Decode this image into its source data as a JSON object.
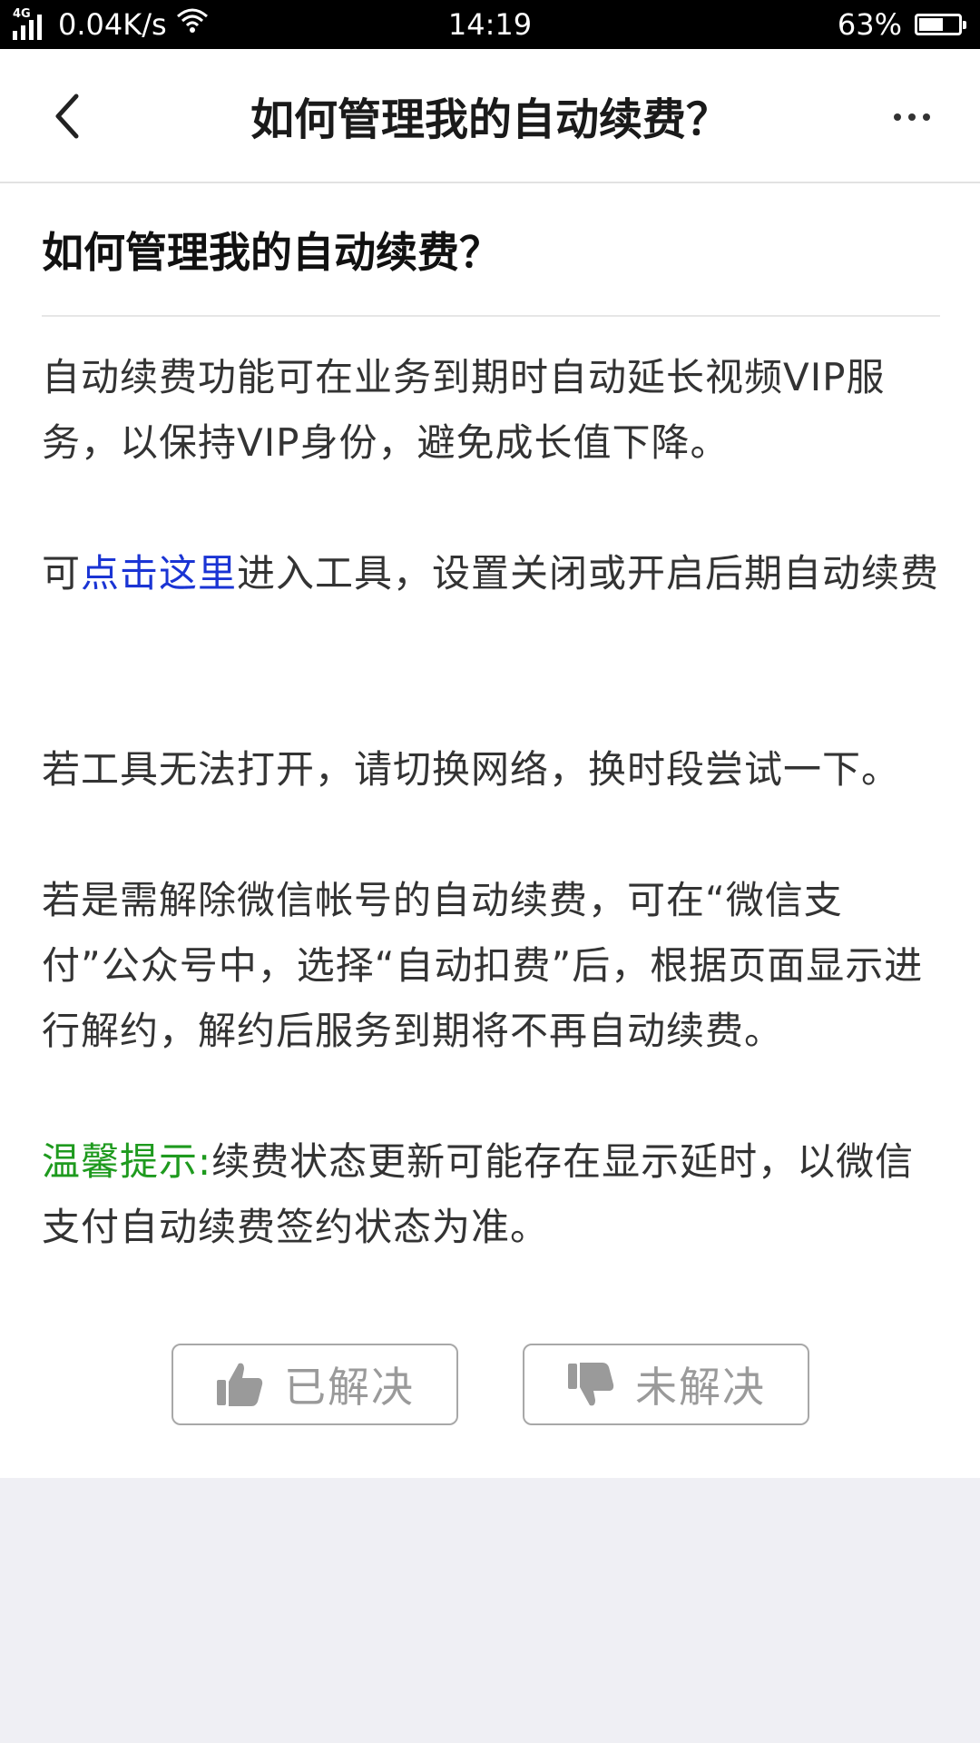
{
  "status_bar": {
    "network_type": "4G",
    "speed": "0.04K/s",
    "time": "14:19",
    "battery": "63%",
    "battery_level": 0.63
  },
  "nav": {
    "title": "如何管理我的自动续费？",
    "back_icon": "chevron-left-icon",
    "more_icon": "more-dots-icon"
  },
  "article": {
    "title": "如何管理我的自动续费？",
    "paragraph1": "自动续费功能可在业务到期时自动延长视频VIP服务，以保持VIP身份，避免成长值下降。",
    "paragraph2_prefix": "可",
    "paragraph2_link": "点击这里",
    "paragraph2_suffix": "进入工具，设置关闭或开启后期自动续费",
    "paragraph3": "若工具无法打开，请切换网络，换时段尝试一下。",
    "paragraph4": "若是需解除微信帐号的自动续费，可在“微信支付”公众号中，选择“自动扣费”后，根据页面显示进行解约，解约后服务到期将不再自动续费。",
    "tip_label": "温馨提示:",
    "tip_text": "续费状态更新可能存在显示延时，以微信支付自动续费签约状态为准。"
  },
  "feedback": {
    "resolved_label": "已解决",
    "unresolved_label": "未解决",
    "resolved_icon": "thumbs-up-icon",
    "unresolved_icon": "thumbs-down-icon"
  },
  "colors": {
    "link": "#1a34d4",
    "tip": "#1e9a1e",
    "background": "#efeff4"
  }
}
